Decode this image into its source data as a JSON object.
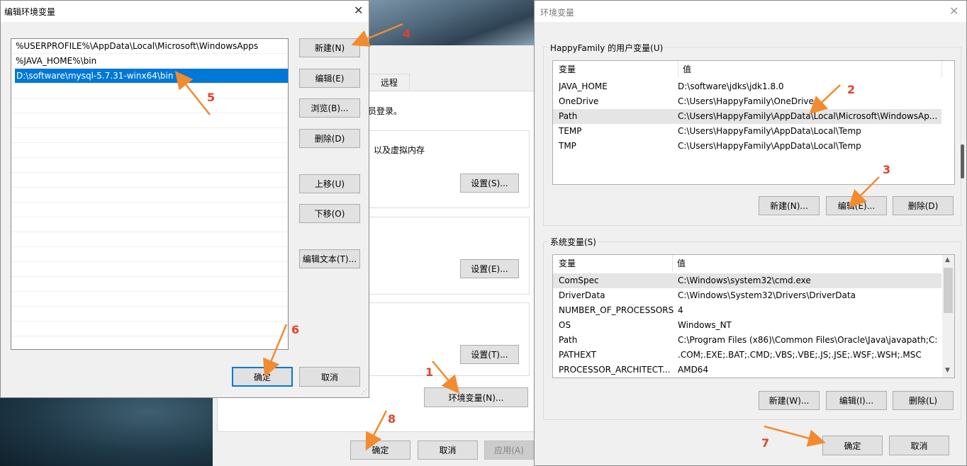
{
  "edit_dialog": {
    "title": "编辑环境变量",
    "entries": [
      "%USERPROFILE%\\AppData\\Local\\Microsoft\\WindowsApps",
      "%JAVA_HOME%\\bin",
      "D:\\software\\mysql-5.7.31-winx64\\bin"
    ],
    "selected_index": 2,
    "buttons": {
      "new": "新建(N)",
      "edit": "编辑(E)",
      "browse": "浏览(B)...",
      "delete": "删除(D)",
      "move_up": "上移(U)",
      "move_down": "下移(O)",
      "edit_text": "编辑文本(T)...",
      "ok": "确定",
      "cancel": "取消"
    }
  },
  "sysprops": {
    "tab_remote": "远程",
    "admin_text": "员登录。",
    "perf_text": "以及虚拟内存",
    "settings_s": "设置(S)...",
    "settings_e": "设置(E)...",
    "settings_t": "设置(T)...",
    "env_button": "环境变量(N)...",
    "ok": "确定",
    "cancel": "取消",
    "apply": "应用(A)"
  },
  "env_dialog": {
    "title": "环境变量",
    "user_group_label": "HappyFamily 的用户变量(U)",
    "col_variable": "变量",
    "col_value": "值",
    "user_vars": [
      {
        "name": "JAVA_HOME",
        "value": "D:\\software\\jdks\\jdk1.8.0"
      },
      {
        "name": "OneDrive",
        "value": "C:\\Users\\HappyFamily\\OneDrive"
      },
      {
        "name": "Path",
        "value": "C:\\Users\\HappyFamily\\AppData\\Local\\Microsoft\\WindowsAp..."
      },
      {
        "name": "TEMP",
        "value": "C:\\Users\\HappyFamily\\AppData\\Local\\Temp"
      },
      {
        "name": "TMP",
        "value": "C:\\Users\\HappyFamily\\AppData\\Local\\Temp"
      }
    ],
    "user_selected_index": 2,
    "user_buttons": {
      "new": "新建(N)...",
      "edit": "编辑(E)...",
      "delete": "删除(D)"
    },
    "system_group_label": "系统变量(S)",
    "system_vars": [
      {
        "name": "ComSpec",
        "value": "C:\\Windows\\system32\\cmd.exe"
      },
      {
        "name": "DriverData",
        "value": "C:\\Windows\\System32\\Drivers\\DriverData"
      },
      {
        "name": "NUMBER_OF_PROCESSORS",
        "value": "4"
      },
      {
        "name": "OS",
        "value": "Windows_NT"
      },
      {
        "name": "Path",
        "value": "C:\\Program Files (x86)\\Common Files\\Oracle\\Java\\javapath;C:..."
      },
      {
        "name": "PATHEXT",
        "value": ".COM;.EXE;.BAT;.CMD;.VBS;.VBE;.JS;.JSE;.WSF;.WSH;.MSC"
      },
      {
        "name": "PROCESSOR_ARCHITECT...",
        "value": "AMD64"
      }
    ],
    "system_selected_index": 0,
    "system_buttons": {
      "new": "新建(W)...",
      "edit": "编辑(I)...",
      "delete": "删除(L)"
    },
    "ok": "确定",
    "cancel": "取消"
  },
  "annotations": [
    "1",
    "2",
    "3",
    "4",
    "5",
    "6",
    "7",
    "8"
  ],
  "colors": {
    "accent": "#0078d7",
    "annotation": "#e0432b",
    "selection": "#0078d7"
  }
}
